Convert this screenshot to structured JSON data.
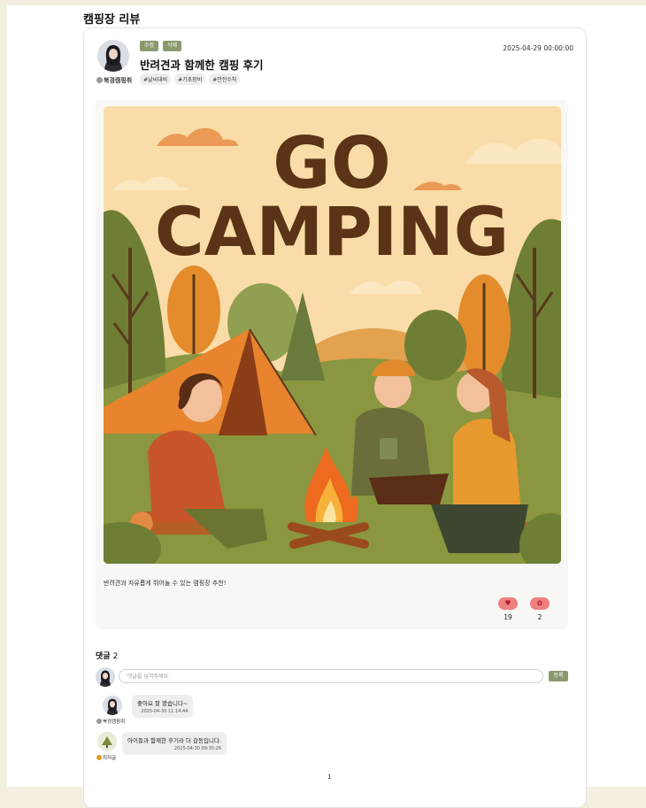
{
  "page": {
    "title": "캠핑장 리뷰"
  },
  "post": {
    "author": "북경캠핑취",
    "edit_label": "수정",
    "delete_label": "삭제",
    "title": "반려견과 함께한 캠핑 후기",
    "date": "2025-04-29 00:00:00",
    "tags": [
      "#날씨대비",
      "#기초장비",
      "#안전수칙"
    ],
    "image": {
      "line1": "GO",
      "line2": "CAMPING"
    },
    "body": "반려견과 자유롭게 뛰어놀 수 있는 캠핑장 추천!",
    "likes": "19",
    "bookmarks": "2"
  },
  "comments": {
    "label": "댓글",
    "count": "2",
    "input_placeholder": "댓글을 남겨주세요.",
    "submit_label": "등록",
    "items": [
      {
        "author": "북경캠핑취",
        "text": "좋아요 잘 봤습니다~",
        "time": "2025-04-30 11:14:44"
      },
      {
        "author": "최저글",
        "text": "아이들과 함께한 후기라 더 감동입니다.",
        "time": "2025-04-30 09:30:26"
      }
    ]
  },
  "pagination": {
    "current": "1"
  },
  "colors": {
    "accent": "#8a9a6e",
    "like": "#f07f7f",
    "background": "#f4efdf"
  }
}
